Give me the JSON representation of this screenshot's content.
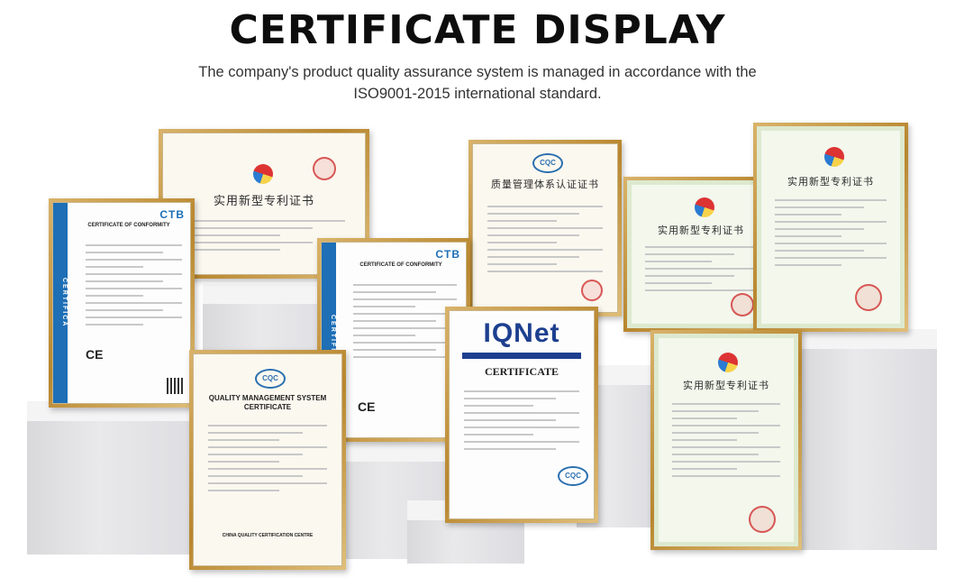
{
  "header": {
    "title": "CERTIFICATE DISPLAY",
    "subtitle_line1": "The company's product quality assurance system is managed in accordance with the",
    "subtitle_line2": "ISO9001-2015 international standard."
  },
  "certificates": {
    "utility_patent_title_cn": "实用新型专利证书",
    "ctb_title": "CERTIFICATE OF CONFORMITY",
    "ctb_brand": "CTB",
    "ctb_side_label": "CERTIFICA",
    "ce_mark": "CE",
    "quality_mgmt_title_cn": "质量管理体系认证证书",
    "quality_mgmt_title_en": "QUALITY MANAGEMENT SYSTEM CERTIFICATE",
    "cqc_label": "CQC",
    "iqnet_brand": "IQNet",
    "iqnet_title": "CERTIFICATE",
    "china_cert_centre": "CHINA QUALITY CERTIFICATION CENTRE"
  },
  "colors": {
    "frame_gold": "#b8862e",
    "ctb_blue": "#1e6fb6",
    "iqnet_blue": "#1d3f8f",
    "seal_red": "#cd2828"
  }
}
